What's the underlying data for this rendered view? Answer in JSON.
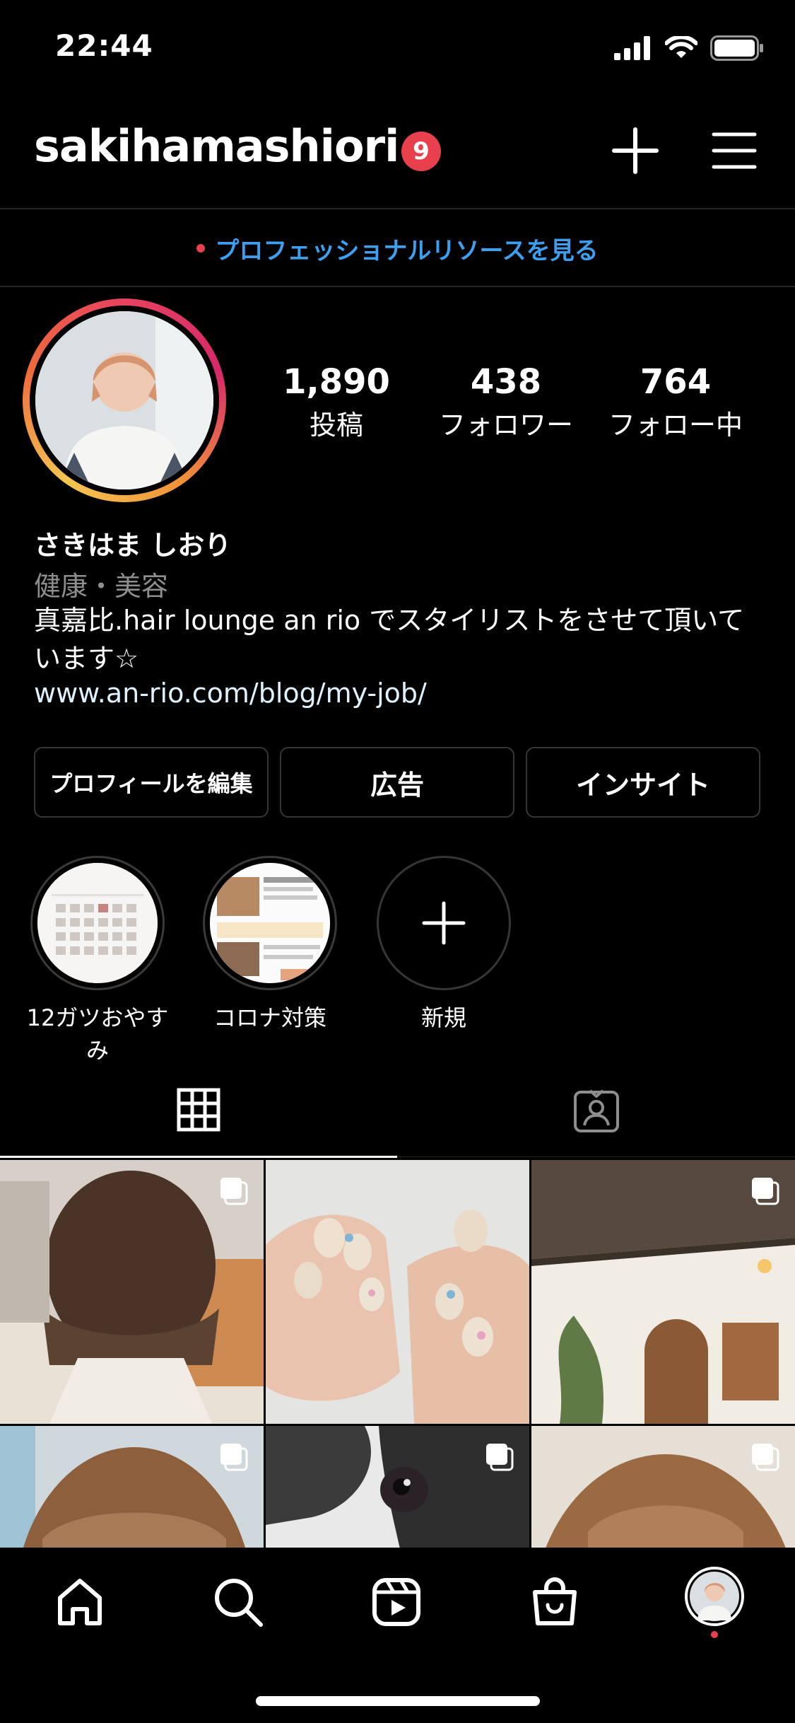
{
  "status_bar": {
    "time": "22:44"
  },
  "header": {
    "username": "sakihamashiori",
    "notification_count": "9"
  },
  "pro_banner": {
    "text": "プロフェッショナルリソースを見る"
  },
  "stats": [
    {
      "value": "1,890",
      "label": "投稿"
    },
    {
      "value": "438",
      "label": "フォロワー"
    },
    {
      "value": "764",
      "label": "フォロー中"
    }
  ],
  "bio": {
    "display_name": "さきはま しおり",
    "category": "健康・美容",
    "text": "真嘉比.hair lounge an rio でスタイリストをさせて頂いています☆",
    "link": "www.an-rio.com/blog/my-job/"
  },
  "actions": [
    {
      "label": "プロフィールを編集"
    },
    {
      "label": "広告"
    },
    {
      "label": "インサイト"
    }
  ],
  "highlights": [
    {
      "label": "12ガツおやすみ"
    },
    {
      "label": "コロナ対策"
    },
    {
      "label": "新規"
    }
  ],
  "colors": {
    "accent_blue": "#3c9ff0",
    "badge_red": "#e8414d",
    "background": "#000000",
    "border": "#363636"
  },
  "icons": {
    "header": [
      "plus-icon",
      "menu-icon"
    ],
    "tabs": [
      "grid-icon",
      "tagged-icon"
    ],
    "nav": [
      "home-icon",
      "search-icon",
      "reels-icon",
      "shop-icon",
      "profile-avatar"
    ]
  }
}
